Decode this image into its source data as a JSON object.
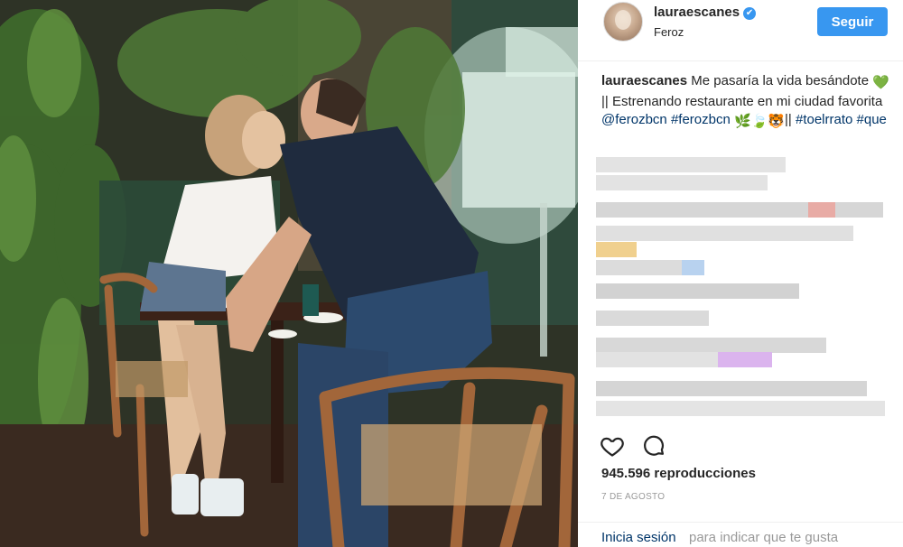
{
  "post": {
    "username": "lauraescanes",
    "verified_mark": "✔",
    "location": "Feroz",
    "follow_label": "Seguir"
  },
  "caption": {
    "username": "lauraescanes",
    "text_1": "Me pasaría la vida besándote",
    "emoji_1": "💚",
    "text_2": "|| Estrenando restaurante en mi ciudad favorita",
    "mention": "@ferozbcn",
    "hashtag_1": "#ferozbcn",
    "emoji_2": "🌿🍃🐯",
    "text_3": "||",
    "hashtag_2": "#toelrrato",
    "hashtag_3": "#que"
  },
  "icons": {
    "like": "heart-icon",
    "comment": "comment-icon"
  },
  "stats": {
    "views": "945.596 reproducciones",
    "date": "7 de agosto"
  },
  "footer": {
    "login_link": "Inicia sesión",
    "login_rest": "para indicar que te gusta"
  },
  "colors": {
    "accent": "#3897f0",
    "link": "#003569",
    "muted": "#999999"
  }
}
